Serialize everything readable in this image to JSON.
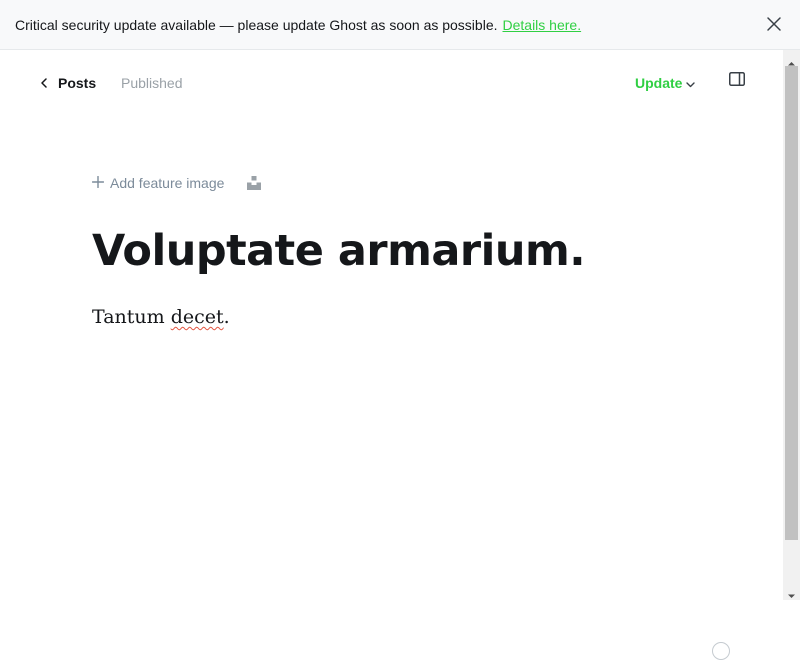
{
  "banner": {
    "message": "Critical security update available — please update Ghost as soon as possible.",
    "link_label": "Details here."
  },
  "header": {
    "back_label": "Posts",
    "status": "Published",
    "update_label": "Update"
  },
  "feature_image": {
    "add_label": "Add feature image"
  },
  "post": {
    "title": "Voluptate armarium.",
    "body_before": "Tantum ",
    "body_misspelled": "decet",
    "body_after": "."
  },
  "colors": {
    "accent": "#30cf43",
    "muted": "#9aa1a7",
    "text": "#15171a",
    "spellcheck": "#e25440"
  },
  "icons": {
    "close": "close-icon",
    "back": "chevron-left-icon",
    "update_dropdown": "chevron-down-icon",
    "sidebar": "sidebar-toggle-icon",
    "add": "plus-icon",
    "unsplash": "unsplash-icon",
    "help": "help-icon"
  }
}
